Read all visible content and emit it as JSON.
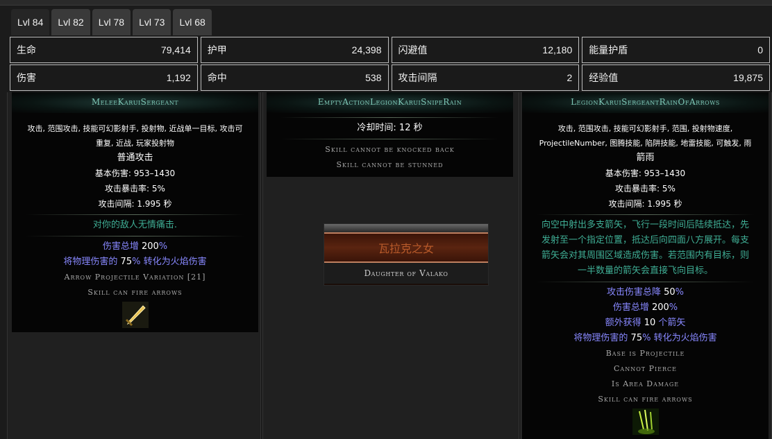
{
  "tabs": [
    {
      "label": "Lvl 84",
      "active": true
    },
    {
      "label": "Lvl 82",
      "active": false
    },
    {
      "label": "Lvl 78",
      "active": false
    },
    {
      "label": "Lvl 73",
      "active": false
    },
    {
      "label": "Lvl 68",
      "active": false
    }
  ],
  "stats": {
    "row1": [
      {
        "label": "生命",
        "value": "79,414"
      },
      {
        "label": "护甲",
        "value": "24,398"
      },
      {
        "label": "闪避值",
        "value": "12,180"
      },
      {
        "label": "能量护盾",
        "value": "0"
      }
    ],
    "row2": [
      {
        "label": "伤害",
        "value": "1,192"
      },
      {
        "label": "命中",
        "value": "538"
      },
      {
        "label": "攻击间隔",
        "value": "2"
      },
      {
        "label": "经验值",
        "value": "19,875"
      }
    ]
  },
  "skill1": {
    "title": "MeleeKaruiSergeant",
    "tags_line1": "攻击, 范围攻击, 技能可幻影射手, 投射物, 近战单一目标, 攻击可",
    "tags_line2": "重复, 近战, 玩家投射物",
    "name": "普通攻击",
    "base_damage": "基本伤害: 953–1430",
    "crit": "攻击暴击率: 5%",
    "interval": "攻击间隔: 1.995 秒",
    "flavor": "对你的敌人无情痛击.",
    "mod1_a": "伤害总增 ",
    "mod1_b": "200",
    "mod1_c": "%",
    "mod2_a": "将物理伤害的 ",
    "mod2_b": "75",
    "mod2_c": "% 转化为火焰伤害",
    "note1": "Arrow Projectile Variation [21]",
    "note2": "Skill can fire arrows",
    "icon": "sword-icon"
  },
  "skill2": {
    "title": "EmptyActionLegionKaruiSnipeRain",
    "cooldown": "冷却时间: 12 秒",
    "note1": "Skill cannot be knocked back",
    "note2": "Skill cannot be stunned"
  },
  "boss": {
    "name": "瓦拉克之女",
    "subtitle": "Daughter of Valako"
  },
  "skill3": {
    "title": "LegionKaruiSergeantRainOfArrows",
    "tags_line1": "攻击, 范围攻击, 技能可幻影射手, 范围, 投射物速度,",
    "tags_line2": "ProjectileNumber, 图腾技能, 陷阱技能, 地雷技能, 可触发, 雨",
    "name": "箭雨",
    "base_damage": "基本伤害: 953–1430",
    "crit": "攻击暴击率: 5%",
    "interval": "攻击间隔: 1.995 秒",
    "flavor_line1": "向空中射出多支箭矢，飞行一段时间后陆续抵达，先",
    "flavor_line2": "发射至一个指定位置，抵达后向四面八方展开。每支",
    "flavor_line3": "箭矢会对其周围区域造成伤害。若范围内有目标，则",
    "flavor_line4": "一半数量的箭矢会直接飞向目标。",
    "mod1_a": "攻击伤害总降 ",
    "mod1_b": "50",
    "mod1_c": "%",
    "mod2_a": "伤害总增 ",
    "mod2_b": "200",
    "mod2_c": "%",
    "mod3_a": "额外获得 ",
    "mod3_b": "10",
    "mod3_c": " 个箭矢",
    "mod4_a": "将物理伤害的 ",
    "mod4_b": "75",
    "mod4_c": "% 转化为火焰伤害",
    "note1": "Base is Projectile",
    "note2": "Cannot Pierce",
    "note3": "Is Area Damage",
    "note4": "Skill can fire arrows",
    "icon": "arrow-rain-icon"
  }
}
